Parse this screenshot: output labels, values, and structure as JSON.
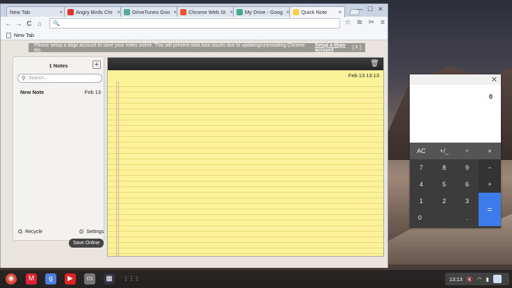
{
  "browser": {
    "tabs": [
      {
        "label": "New Tab",
        "icon_color": "#dfe5ee"
      },
      {
        "label": "Angry Birds Chr",
        "icon_color": "#d33"
      },
      {
        "label": "DriveTunes Goo",
        "icon_color": "#5a9"
      },
      {
        "label": "Chrome Web St",
        "icon_color": "#e53"
      },
      {
        "label": "My Drive - Goog",
        "icon_color": "#4a8"
      },
      {
        "label": "Quick Note",
        "icon_color": "#f3d44a"
      }
    ],
    "tab_close": "×",
    "window_controls": {
      "minimize": "—",
      "maximize": "☐",
      "close": "✕"
    },
    "nav": {
      "back": "←",
      "forward": "→",
      "reload": "C",
      "home": "⌂"
    },
    "omnibox": {
      "value": "",
      "search_icon": "🔍"
    },
    "bookmark": {
      "label": "New Tab"
    }
  },
  "notice": {
    "text": "Please setup a diigo account to save your notes online. This will prevent data loss issues due to updating/uninstalling Chrome etc.",
    "link": "Setup a diigo account",
    "close": "[ X ]"
  },
  "sidebar": {
    "title": "1 Notes",
    "add": "+",
    "search_placeholder": "Search...",
    "notes": [
      {
        "title": "New Note",
        "date": "Feb 13"
      }
    ],
    "recycle": "Recycle",
    "settings": "Settings",
    "tooltip": "Save Online"
  },
  "editor": {
    "date": "Feb 13 13:13",
    "trash": "🗑"
  },
  "calculator": {
    "display": "0",
    "close": "✕",
    "keys": [
      [
        "AC",
        "+/_",
        "÷",
        "×"
      ],
      [
        "7",
        "8",
        "9",
        "−"
      ],
      [
        "4",
        "5",
        "6",
        "+"
      ],
      [
        "1",
        "2",
        "3",
        "="
      ],
      [
        "0",
        "",
        ".",
        ""
      ]
    ]
  },
  "shelf": {
    "apps": [
      {
        "name": "chrome",
        "color": "#dd4b39",
        "glyph": "◉"
      },
      {
        "name": "gmail",
        "color": "#d23",
        "glyph": "M"
      },
      {
        "name": "google",
        "color": "#4a7ee0",
        "glyph": "g"
      },
      {
        "name": "youtube",
        "color": "#d22",
        "glyph": "▶"
      },
      {
        "name": "files",
        "color": "#777",
        "glyph": "▭"
      },
      {
        "name": "quick-note",
        "color": "#334",
        "glyph": "▦"
      }
    ],
    "launcher": "⋮⋮⋮",
    "time": "13:13"
  }
}
